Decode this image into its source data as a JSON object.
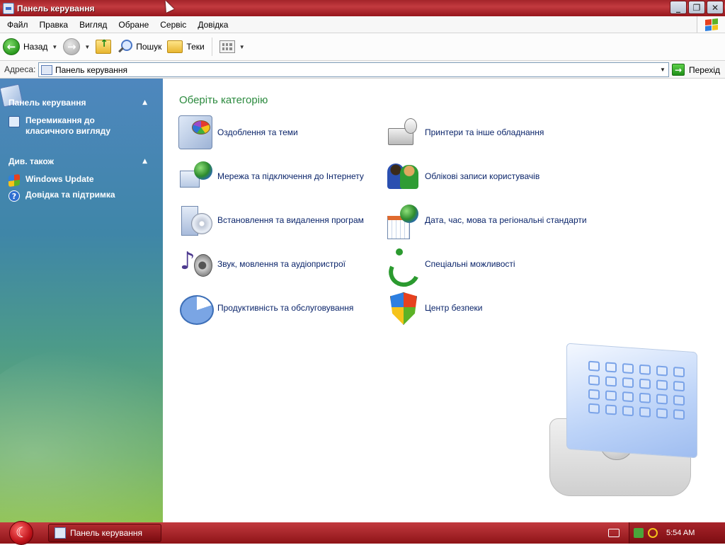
{
  "window": {
    "title": "Панель керування",
    "controls": {
      "minimize": "_",
      "maximize": "❐",
      "close": "✕"
    }
  },
  "menu": [
    "Файл",
    "Правка",
    "Вигляд",
    "Обране",
    "Сервіс",
    "Довідка"
  ],
  "toolbar": {
    "back_label": "Назад",
    "search_label": "Пошук",
    "folders_label": "Теки"
  },
  "address": {
    "label": "Адреса:",
    "value": "Панель керування",
    "go_label": "Перехід"
  },
  "sidebar": {
    "panel": {
      "title": "Панель керування",
      "items": [
        {
          "label": "Перемикання до класичного вигляду",
          "icon": "switch-view-icon"
        }
      ]
    },
    "see_also": {
      "title": "Див. також",
      "items": [
        {
          "label": "Windows Update",
          "icon": "windows-update-icon"
        },
        {
          "label": "Довідка та підтримка",
          "icon": "help-icon"
        }
      ]
    }
  },
  "main": {
    "heading": "Оберіть категорію",
    "categories": [
      {
        "label": "Оздоблення та теми",
        "icon": "appearance-themes-icon"
      },
      {
        "label": "Мережа та підключення до Інтернету",
        "icon": "network-icon"
      },
      {
        "label": "Встановлення та видалення програм",
        "icon": "add-remove-programs-icon"
      },
      {
        "label": "Звук, мовлення та аудіопристрої",
        "icon": "sound-icon"
      },
      {
        "label": "Продуктивність та обслуговування",
        "icon": "performance-icon"
      },
      {
        "label": "Принтери та інше обладнання",
        "icon": "printers-icon"
      },
      {
        "label": "Облікові записи користувачів",
        "icon": "user-accounts-icon"
      },
      {
        "label": "Дата, час, мова та регіональні стандарти",
        "icon": "date-time-icon"
      },
      {
        "label": "Спеціальні можливості",
        "icon": "accessibility-icon"
      },
      {
        "label": "Центр безпеки",
        "icon": "security-center-icon"
      }
    ]
  },
  "taskbar": {
    "window_button": "Панель керування",
    "clock": "5:54 AM"
  },
  "colors": {
    "titlebar": "#b0262c",
    "heading_green": "#2b8a3e",
    "link_blue": "#0a246a"
  }
}
